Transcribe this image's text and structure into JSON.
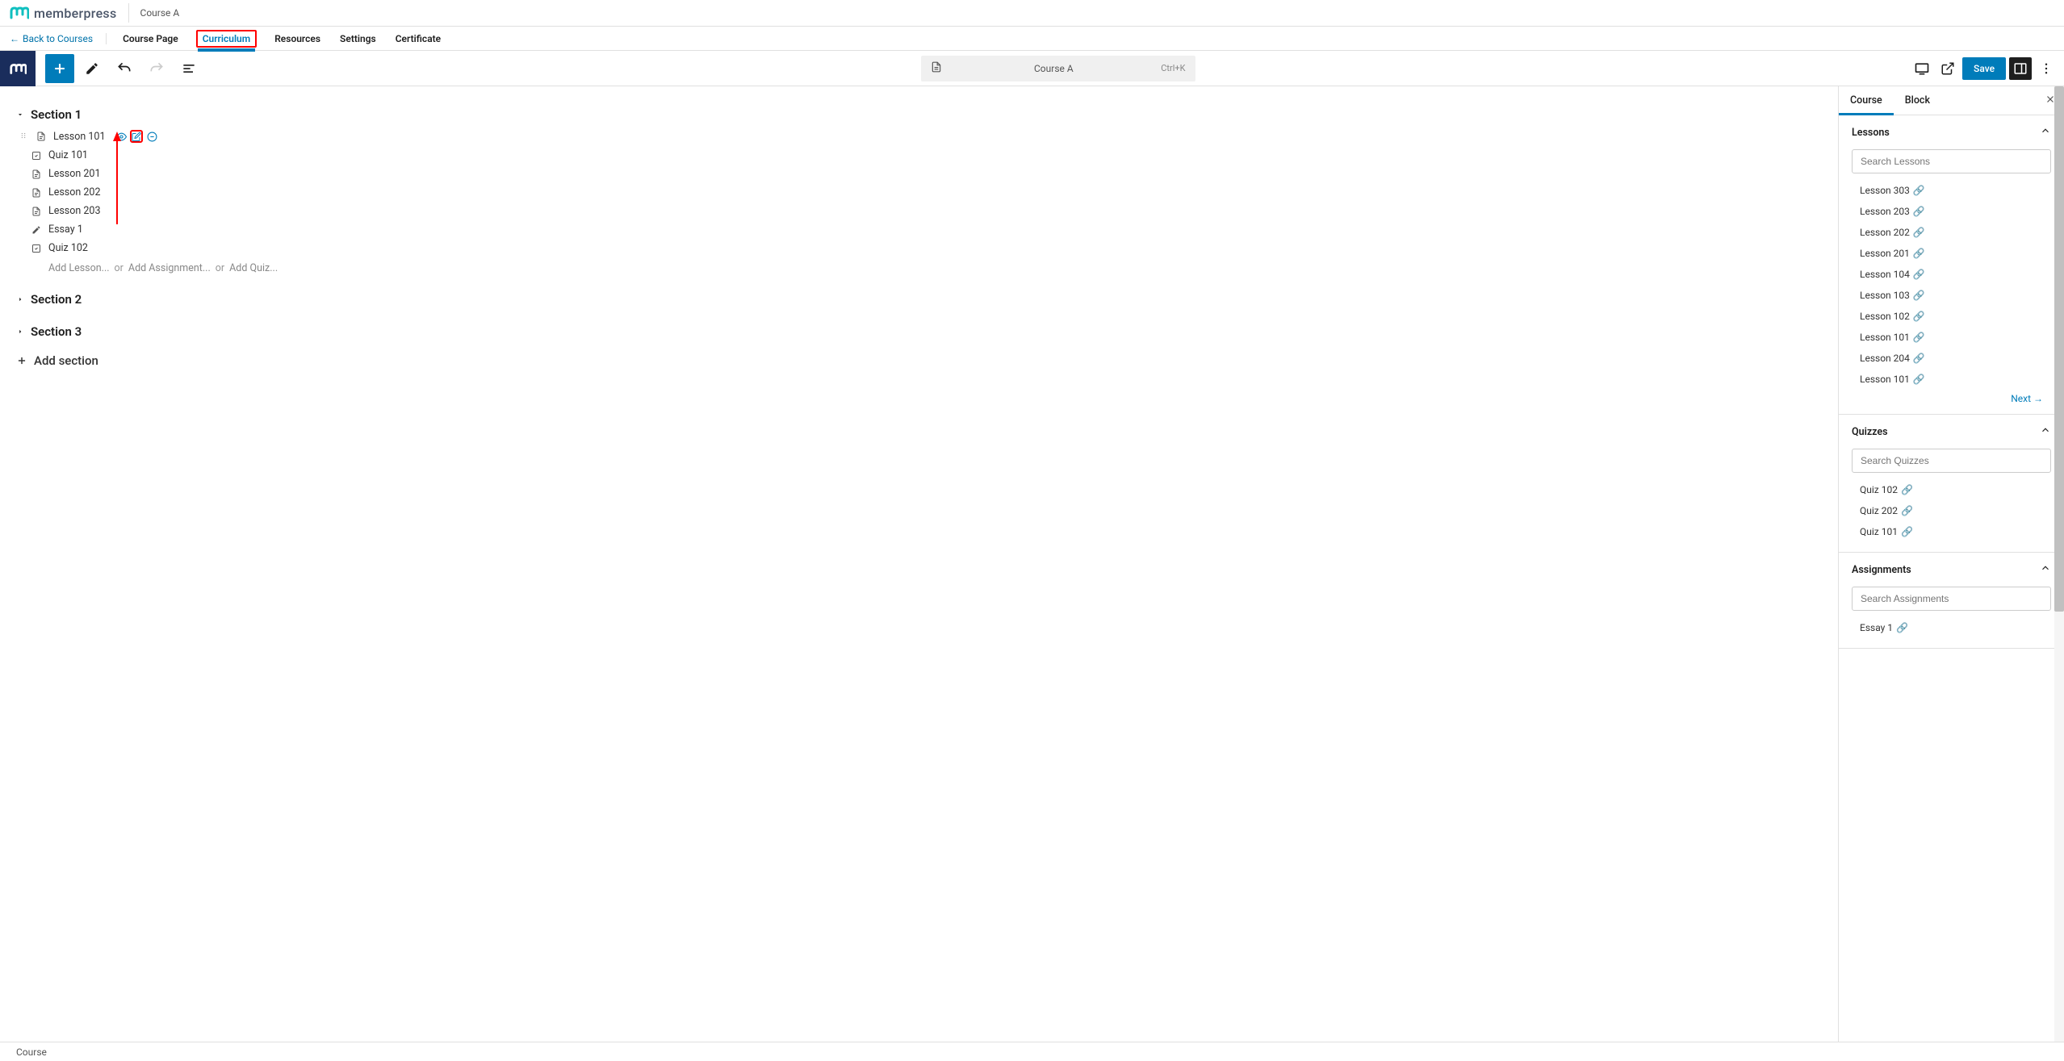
{
  "brand": {
    "name": "memberpress"
  },
  "course": {
    "name": "Course A"
  },
  "back_link": "Back to Courses",
  "nav_tabs": [
    {
      "label": "Course Page",
      "active": false
    },
    {
      "label": "Curriculum",
      "active": true,
      "highlighted": true
    },
    {
      "label": "Resources",
      "active": false
    },
    {
      "label": "Settings",
      "active": false
    },
    {
      "label": "Certificate",
      "active": false
    }
  ],
  "title_bar": {
    "title": "Course A",
    "shortcut": "Ctrl+K"
  },
  "save_label": "Save",
  "curriculum": {
    "sections": [
      {
        "title": "Section 1",
        "expanded": true,
        "items": [
          {
            "type": "lesson",
            "label": "Lesson 101",
            "active": true
          },
          {
            "type": "quiz",
            "label": "Quiz 101"
          },
          {
            "type": "lesson",
            "label": "Lesson 201"
          },
          {
            "type": "lesson",
            "label": "Lesson 202"
          },
          {
            "type": "lesson",
            "label": "Lesson 203"
          },
          {
            "type": "essay",
            "label": "Essay 1"
          },
          {
            "type": "quiz",
            "label": "Quiz 102"
          }
        ]
      },
      {
        "title": "Section 2",
        "expanded": false,
        "items": []
      },
      {
        "title": "Section 3",
        "expanded": false,
        "items": []
      }
    ],
    "add_options": {
      "lesson": "Add Lesson...",
      "assignment": "Add Assignment...",
      "quiz": "Add Quiz...",
      "or": "or"
    },
    "add_section": "Add section"
  },
  "sidebar": {
    "tabs": {
      "course": "Course",
      "block": "Block"
    },
    "panels": {
      "lessons": {
        "title": "Lessons",
        "search_placeholder": "Search Lessons",
        "items": [
          "Lesson 303",
          "Lesson 203",
          "Lesson 202",
          "Lesson 201",
          "Lesson 104",
          "Lesson 103",
          "Lesson 102",
          "Lesson 101",
          "Lesson 204",
          "Lesson 101"
        ],
        "next": "Next"
      },
      "quizzes": {
        "title": "Quizzes",
        "search_placeholder": "Search Quizzes",
        "items": [
          "Quiz 102",
          "Quiz 202",
          "Quiz 101"
        ]
      },
      "assignments": {
        "title": "Assignments",
        "search_placeholder": "Search Assignments",
        "items": [
          "Essay 1"
        ]
      }
    }
  },
  "footer": {
    "breadcrumb": "Course"
  }
}
